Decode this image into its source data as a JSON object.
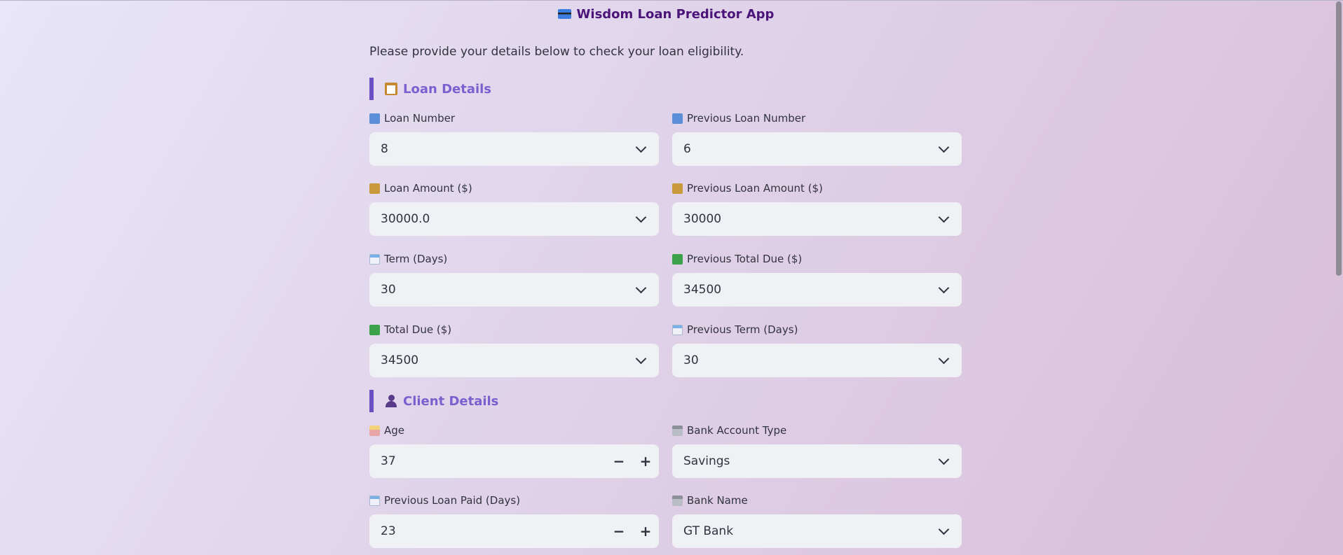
{
  "app": {
    "title": "Wisdom Loan Predictor App",
    "title_icon": "credit-card-icon",
    "intro": "Please provide your details below to check your loan eligibility."
  },
  "sections": {
    "loan": {
      "title": "Loan Details",
      "icon": "clipboard-icon"
    },
    "client": {
      "title": "Client Details",
      "icon": "person-icon"
    }
  },
  "fields": {
    "loan_number": {
      "label": "Loan Number",
      "value": "8",
      "icon": "numbers-icon"
    },
    "prev_loan_number": {
      "label": "Previous Loan Number",
      "value": "6",
      "icon": "numbers-icon"
    },
    "loan_amount": {
      "label": "Loan Amount ($)",
      "value": "30000.0",
      "icon": "money-bag-icon"
    },
    "prev_loan_amount": {
      "label": "Previous Loan Amount ($)",
      "value": "30000",
      "icon": "money-bag-icon"
    },
    "term": {
      "label": "Term (Days)",
      "value": "30",
      "icon": "calendar-icon"
    },
    "prev_total_due": {
      "label": "Previous Total Due ($)",
      "value": "34500",
      "icon": "banknote-icon"
    },
    "total_due": {
      "label": "Total Due ($)",
      "value": "34500",
      "icon": "banknote-icon"
    },
    "prev_term": {
      "label": "Previous Term (Days)",
      "value": "30",
      "icon": "calendar-icon"
    },
    "age": {
      "label": "Age",
      "value": "37",
      "icon": "birthday-cake-icon",
      "decrement": "−",
      "increment": "+"
    },
    "bank_account_type": {
      "label": "Bank Account Type",
      "value": "Savings",
      "icon": "bank-icon"
    },
    "prev_loan_paid": {
      "label": "Previous Loan Paid (Days)",
      "value": "23",
      "icon": "calendar-icon",
      "decrement": "−",
      "increment": "+"
    },
    "bank_name": {
      "label": "Bank Name",
      "value": "GT Bank",
      "icon": "bank-icon"
    }
  }
}
